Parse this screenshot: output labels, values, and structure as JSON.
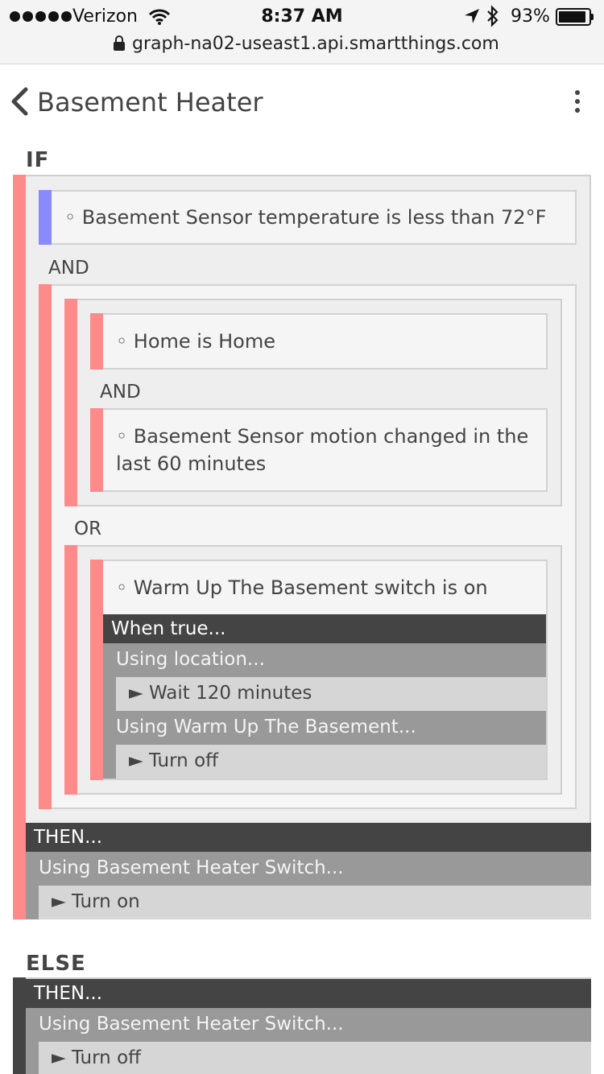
{
  "status_bar": {
    "carrier": "Verizon",
    "time": "8:37 AM",
    "battery": "93%",
    "url": "graph-na02-useast1.api.smartthings.com"
  },
  "nav": {
    "title": "Basement Heater"
  },
  "if_section": {
    "header": "IF",
    "condition_temperature": "◦ Basement Sensor temperature is less than 72°F",
    "and_1": "AND",
    "condition_home": "◦ Home is Home",
    "and_2": "AND",
    "condition_motion": "◦ Basement Sensor motion changed in the last 60 minutes",
    "or_1": "OR",
    "condition_switch": "◦ Warm Up The Basement switch is on",
    "when_true": "When true...",
    "using_location": "Using location...",
    "wait_action": "► Wait 120 minutes",
    "using_warmup": "Using Warm Up The Basement...",
    "turn_off_warmup": "► Turn off"
  },
  "then_section": {
    "header": "THEN...",
    "using_device": "Using Basement Heater Switch...",
    "action": "► Turn on"
  },
  "else_section": {
    "header": "ELSE",
    "then_header": "THEN...",
    "using_device": "Using Basement Heater Switch...",
    "action": "► Turn off"
  },
  "colors": {
    "condition_bar_red": "#ff8a8a",
    "condition_bar_blue": "#8a8aff",
    "dark_band": "#444444",
    "mid_band": "#999999",
    "light_band": "#d6d6d6"
  }
}
